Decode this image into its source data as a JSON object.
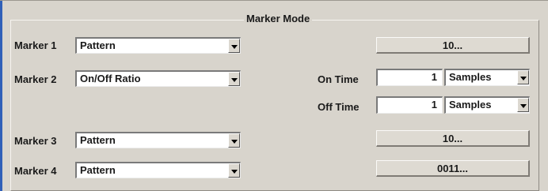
{
  "title": "Marker Mode",
  "markers": {
    "m1": {
      "label": "Marker 1",
      "mode": "Pattern",
      "button": "10..."
    },
    "m2": {
      "label": "Marker 2",
      "mode": "On/Off Ratio"
    },
    "m3": {
      "label": "Marker 3",
      "mode": "Pattern",
      "button": "10..."
    },
    "m4": {
      "label": "Marker 4",
      "mode": "Pattern",
      "button": "0011..."
    }
  },
  "on_time": {
    "label": "On Time",
    "value": "1",
    "unit": "Samples"
  },
  "off_time": {
    "label": "Off Time",
    "value": "1",
    "unit": "Samples"
  },
  "icons": {
    "dropdown": "chevron-down-icon"
  },
  "colors": {
    "background": "#d8d4cc",
    "accent": "#3060b8",
    "field": "#ffffff"
  }
}
